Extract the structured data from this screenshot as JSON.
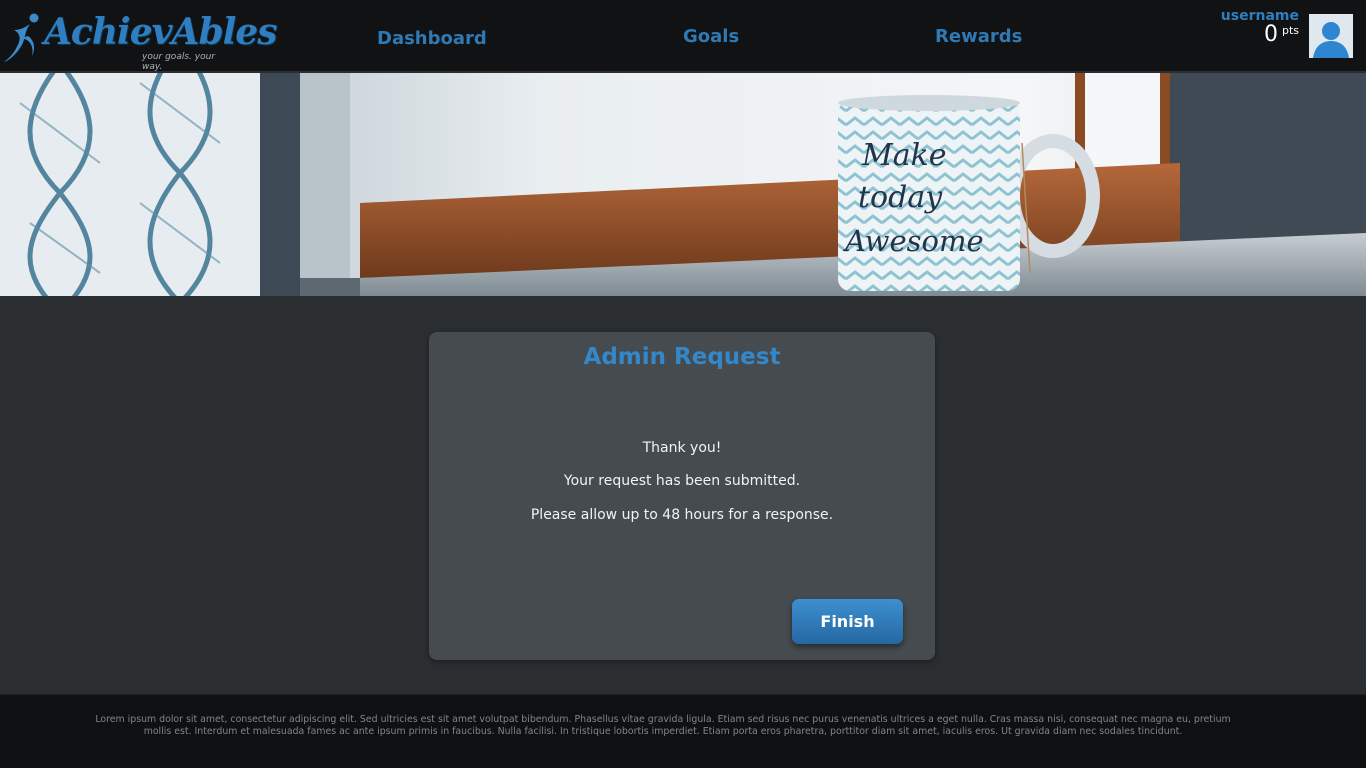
{
  "brand": {
    "name": "AchievAbles",
    "tagline": "your goals. your way.",
    "accent_color": "#2f7fc0"
  },
  "nav": {
    "items": [
      {
        "label": "Dashboard"
      },
      {
        "label": "Goals"
      },
      {
        "label": "Rewards"
      }
    ]
  },
  "user": {
    "name": "username",
    "points": "0",
    "points_unit": "pts",
    "avatar_icon": "user-avatar-icon"
  },
  "hero": {
    "mug_text": [
      "Make",
      "today",
      "Awesome"
    ]
  },
  "card": {
    "title": "Admin Request",
    "lines": [
      "Thank you!",
      "Your request has been submitted.",
      "Please allow up to 48 hours for a response."
    ],
    "finish_label": "Finish"
  },
  "footer": {
    "text": "Lorem ipsum dolor sit amet, consectetur adipiscing elit. Sed ultricies est sit amet volutpat bibendum. Phasellus vitae gravida ligula. Etiam sed risus nec purus venenatis ultrices a eget nulla. Cras massa nisi, consequat nec magna eu, pretium mollis est. Interdum et malesuada fames ac ante ipsum primis in faucibus. Nulla facilisi. In tristique lobortis imperdiet. Etiam porta eros pharetra, porttitor diam sit amet, iaculis eros. Ut gravida diam nec sodales tincidunt."
  }
}
